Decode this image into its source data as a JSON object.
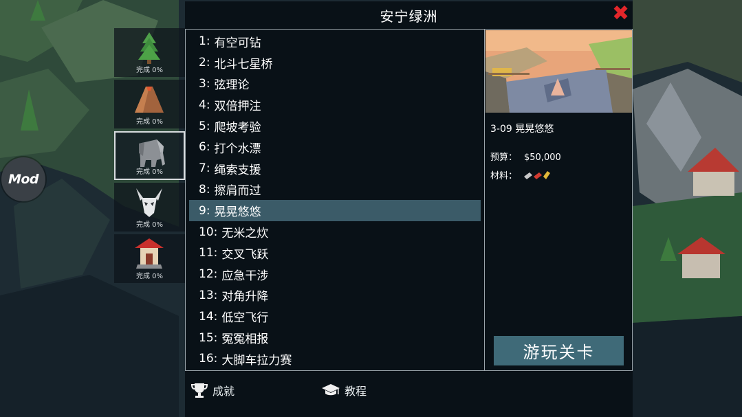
{
  "mod_label": "Mod",
  "dialog": {
    "title": "安宁绿洲",
    "close_glyph": "✖"
  },
  "worlds": [
    {
      "icon": "pine-tree-icon",
      "progress": "完成 0%"
    },
    {
      "icon": "volcano-icon",
      "progress": "完成 0%"
    },
    {
      "icon": "elephant-icon",
      "progress": "完成 0%",
      "selected": true
    },
    {
      "icon": "skull-icon",
      "progress": "完成 0%"
    },
    {
      "icon": "pagoda-icon",
      "progress": "完成 0%"
    }
  ],
  "levels": [
    {
      "num": "1:",
      "name": "有空可钻"
    },
    {
      "num": "2:",
      "name": "北斗七星桥"
    },
    {
      "num": "3:",
      "name": "弦理论"
    },
    {
      "num": "4:",
      "name": "双倍押注"
    },
    {
      "num": "5:",
      "name": "爬坡考验"
    },
    {
      "num": "6:",
      "name": "打个水漂"
    },
    {
      "num": "7:",
      "name": "绳索支援"
    },
    {
      "num": "8:",
      "name": "擦肩而过"
    },
    {
      "num": "9:",
      "name": "晃晃悠悠"
    },
    {
      "num": "10:",
      "name": "无米之炊"
    },
    {
      "num": "11:",
      "name": "交叉飞跃"
    },
    {
      "num": "12:",
      "name": "应急干涉"
    },
    {
      "num": "13:",
      "name": "对角升降"
    },
    {
      "num": "14:",
      "name": "低空飞行"
    },
    {
      "num": "15:",
      "name": "冤冤相报"
    },
    {
      "num": "16:",
      "name": "大脚车拉力赛"
    }
  ],
  "selected_level_index": 8,
  "detail": {
    "title": "3-09 晃晃悠悠",
    "budget_label": "预算：",
    "budget_value": "$50,000",
    "materials_label": "材料：",
    "materials": [
      "road-material-icon",
      "wood-material-icon",
      "steel-material-icon"
    ],
    "play_label": "游玩关卡"
  },
  "footer": {
    "achievements_label": "成就",
    "tutorial_label": "教程"
  },
  "colors": {
    "selected_row": "#3b5b68",
    "play_button": "#3f6a78",
    "close": "#e3262a"
  }
}
